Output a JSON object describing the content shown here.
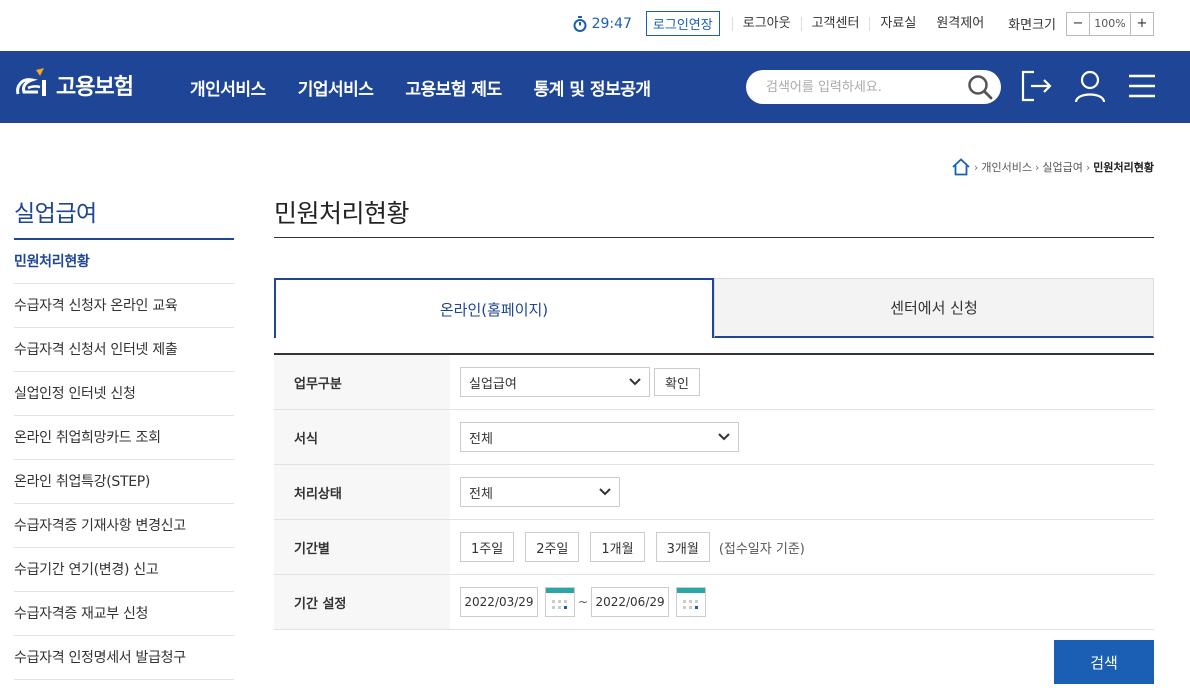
{
  "util": {
    "timer": "29:47",
    "extend_label": "로그인연장",
    "links": [
      "로그아웃",
      "고객센터",
      "자료실",
      "원격제어"
    ],
    "zoom_label": "화면크기",
    "zoom_minus": "−",
    "zoom_value": "100%",
    "zoom_plus": "+"
  },
  "gnb": {
    "logo_text": "고용보험",
    "menu": [
      "개인서비스",
      "기업서비스",
      "고용보험 제도",
      "통계 및 정보공개"
    ],
    "search_placeholder": "검색어를 입력하세요."
  },
  "breadcrumb": {
    "items": [
      "개인서비스",
      "실업급여"
    ],
    "current": "민원처리현황"
  },
  "sidebar": {
    "title": "실업급여",
    "items": [
      "민원처리현황",
      "수급자격 신청자 온라인 교육",
      "수급자격 신청서 인터넷 제출",
      "실업인정 인터넷 신청",
      "온라인 취업희망카드 조회",
      "온라인 취업특강(STEP)",
      "수급자격증 기재사항 변경신고",
      "수급기간 연기(변경) 신고",
      "수급자격증 재교부 신청",
      "수급자격 인정명세서 발급청구"
    ]
  },
  "main": {
    "title": "민원처리현황",
    "tabs": [
      "온라인(홈페이지)",
      "센터에서 신청"
    ],
    "form": {
      "work_label": "업무구분",
      "work_value": "실업급여",
      "confirm_label": "확인",
      "format_label": "서식",
      "format_value": "전체",
      "status_label": "처리상태",
      "status_value": "전체",
      "period_label": "기간별",
      "period_options": [
        "1주일",
        "2주일",
        "1개월",
        "3개월"
      ],
      "period_note": "(접수일자 기준)",
      "range_label": "기간 설정",
      "date_from": "2022/03/29",
      "date_to": "2022/06/29",
      "tilde": "~"
    },
    "search_label": "검색"
  },
  "colors": {
    "brand": "#1e4596",
    "accent": "#1a5fb4"
  }
}
